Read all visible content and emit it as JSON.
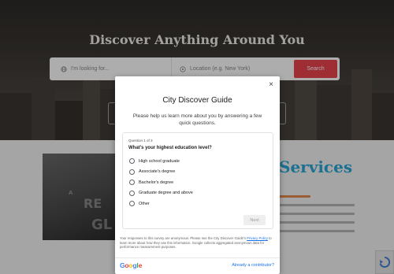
{
  "hero": {
    "title": "Discover Anything Around You"
  },
  "search": {
    "what_placeholder": "I'm looking for...",
    "where_placeholder": "Location (e.g. New York)",
    "button_label": "Search"
  },
  "promo": {
    "word1": "A",
    "word2": "RE",
    "word3": "GL"
  },
  "services": {
    "title": "Services"
  },
  "survey": {
    "title": "City Discover Guide",
    "subtitle": "Please help us learn more about you by answering a few quick questions.",
    "question_counter": "Question 1 of 3",
    "question": "What's your highest education level?",
    "options": [
      "High school graduate",
      "Associate's degree",
      "Bachelor's degree",
      "Graduate degree and above",
      "Other"
    ],
    "next_label": "Next",
    "disclaimer_before": "Your responses to this survey are anonymous. Please see the City Discover Guide's ",
    "privacy_link": "Privacy Policy",
    "disclaimer_after": " to learn more about how they use this information. Google collects aggregated anonymous data for performance measurement purposes.",
    "contributor_link": "Already a contributor?",
    "close_symbol": "×"
  },
  "colors": {
    "accent_red": "#e9454d",
    "services_blue": "#2aa7d8",
    "google_blue": "#1a73e8"
  },
  "icons": {
    "search_field": "globe-icon",
    "location_field": "location-pin-icon",
    "close": "close-icon",
    "recaptcha": "recaptcha-icon"
  }
}
